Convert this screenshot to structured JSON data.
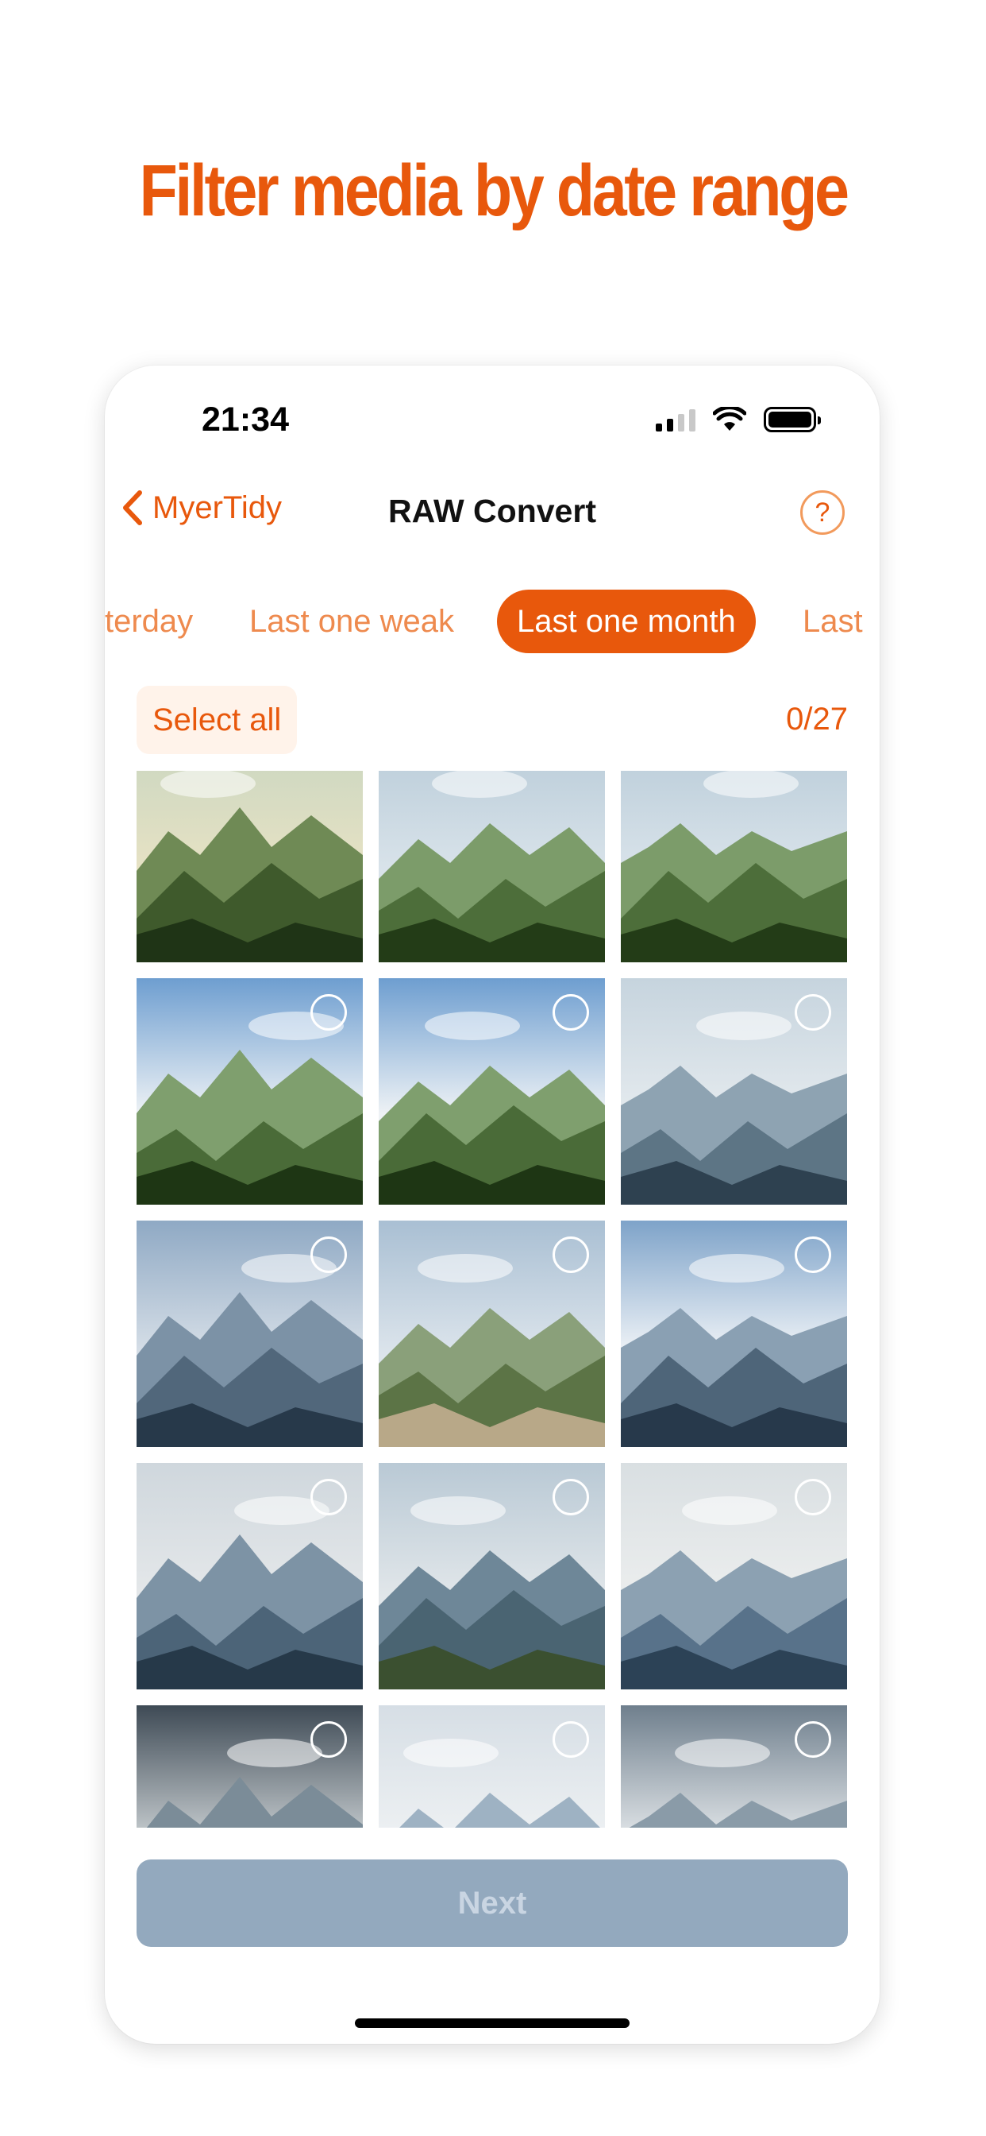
{
  "headline": "Filter media by date range",
  "status_bar": {
    "time": "21:34"
  },
  "nav": {
    "back_label": "MyerTidy",
    "title": "RAW Convert",
    "help_label": "?"
  },
  "filters": [
    {
      "label": "terday",
      "active": false
    },
    {
      "label": "Last one weak",
      "active": false
    },
    {
      "label": "Last one month",
      "active": true
    },
    {
      "label": "Last",
      "active": false
    }
  ],
  "selection": {
    "select_all_label": "Select all",
    "count": "0/27"
  },
  "photos": [
    {
      "scene": "green-valley-sunlit"
    },
    {
      "scene": "green-karst-peaks"
    },
    {
      "scene": "green-karst-peaks"
    },
    {
      "scene": "green-karst-clouds"
    },
    {
      "scene": "green-karst-clouds"
    },
    {
      "scene": "hazy-blue-mountains"
    },
    {
      "scene": "hazy-blue-ridges"
    },
    {
      "scene": "ridge-trail"
    },
    {
      "scene": "blue-sky-karst"
    },
    {
      "scene": "misty-valley"
    },
    {
      "scene": "valley-river"
    },
    {
      "scene": "misty-valley-light"
    },
    {
      "scene": "dark-cloud-mountains"
    },
    {
      "scene": "pale-mist-peaks"
    },
    {
      "scene": "cloudy-sky-peaks"
    }
  ],
  "next_button": {
    "label": "Next",
    "enabled": false
  },
  "colors": {
    "accent": "#E8580C",
    "disabled_button": "#93A9BE"
  }
}
